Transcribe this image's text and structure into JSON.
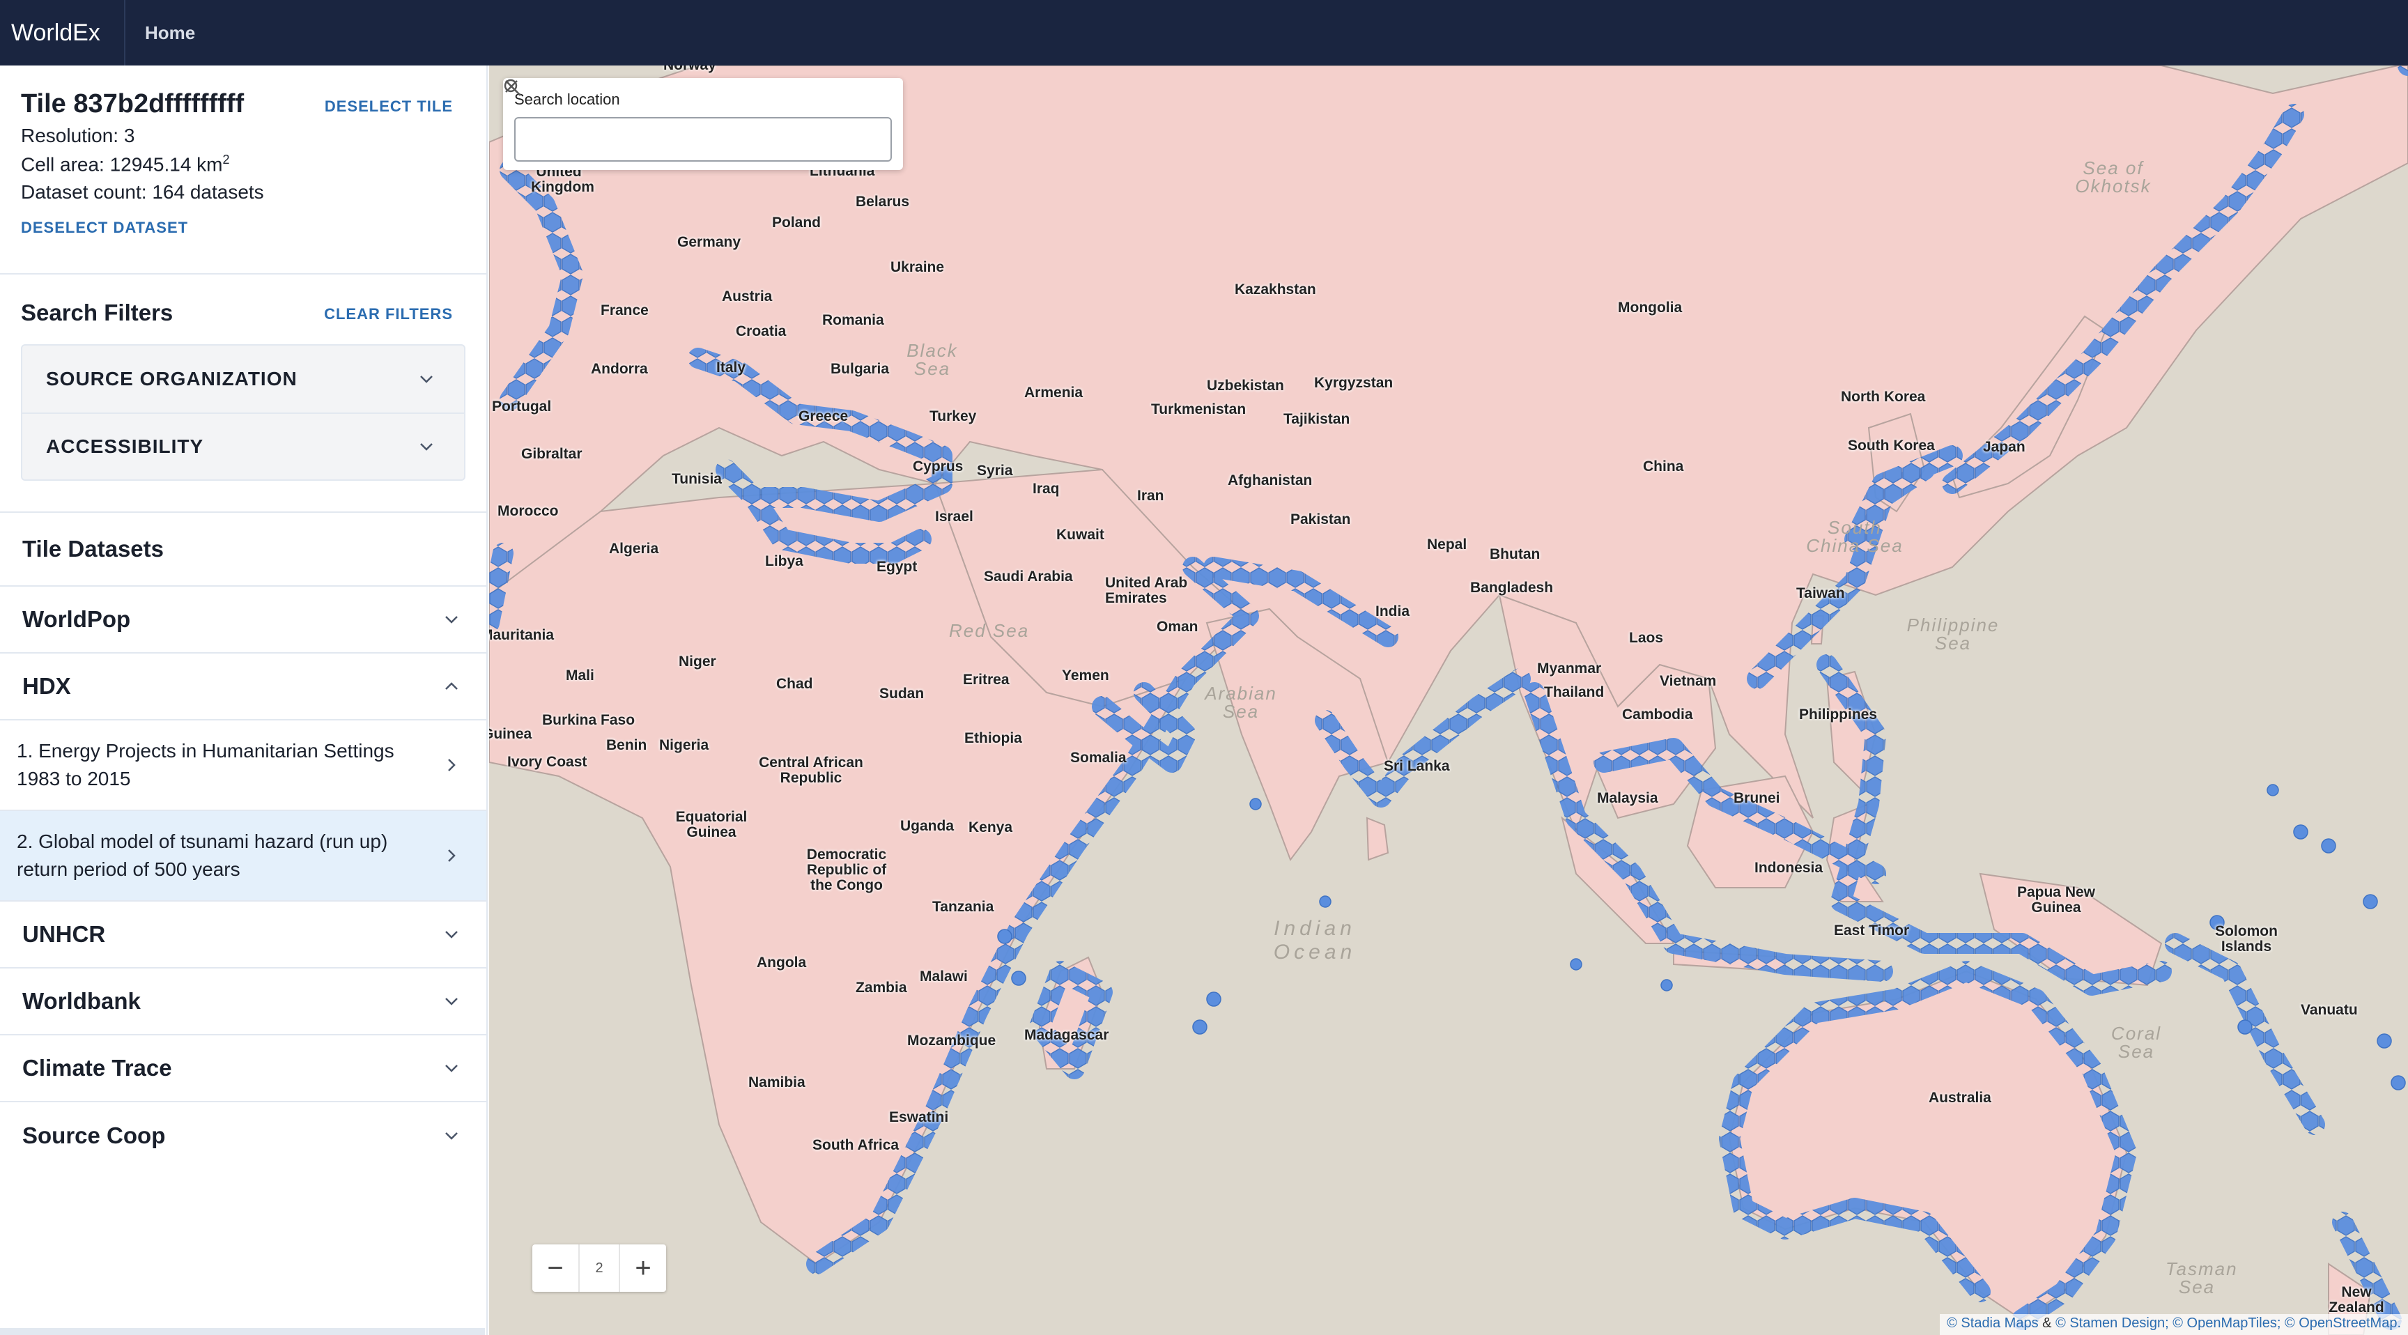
{
  "app": {
    "brand": "WorldEx",
    "nav_home": "Home"
  },
  "tile": {
    "title": "Tile 837b2dfffffffff",
    "deselect_tile": "DESELECT TILE",
    "resolution": "Resolution: 3",
    "cell_area_prefix": "Cell area: 12945.14 km",
    "cell_area_sup": "2",
    "dataset_count": "Dataset count: 164 datasets",
    "deselect_dataset": "DESELECT DATASET"
  },
  "filters": {
    "title": "Search Filters",
    "clear": "CLEAR FILTERS",
    "items": [
      {
        "label": "SOURCE ORGANIZATION"
      },
      {
        "label": "ACCESSIBILITY"
      }
    ]
  },
  "datasets": {
    "title": "Tile Datasets",
    "groups": [
      {
        "label": "WorldPop",
        "expanded": false
      },
      {
        "label": "HDX",
        "expanded": true
      },
      {
        "label": "UNHCR",
        "expanded": false
      },
      {
        "label": "Worldbank",
        "expanded": false
      },
      {
        "label": "Climate Trace",
        "expanded": false
      },
      {
        "label": "Source Coop",
        "expanded": false
      }
    ],
    "hdx_items": [
      {
        "label": "1. Energy Projects in Humanitarian Settings 1983 to 2015",
        "selected": false
      },
      {
        "label": "2. Global model of tsunami hazard (run up) return period of 500 years",
        "selected": true
      }
    ]
  },
  "map": {
    "search_label": "Search location",
    "search_value": "",
    "search_placeholder": "",
    "zoom_level": "2",
    "zoom_out": "−",
    "zoom_in": "+",
    "attribution": {
      "stadia": "© Stadia Maps",
      "amp": "&",
      "stamen": "© Stamen Design;",
      "omt": "© OpenMapTiles;",
      "osm": "© OpenStreetMap."
    },
    "colors": {
      "hazard_hex": "#5b8ede",
      "land": "#f4d0cc",
      "water": "#ddd8cd"
    },
    "labels": [
      "Norway",
      "United Kingdom",
      "Lithuania",
      "Belarus",
      "Poland",
      "Germany",
      "Ukraine",
      "France",
      "Austria",
      "Romania",
      "Croatia",
      "Italy",
      "Bulgaria",
      "Andorra",
      "Portugal",
      "Gibraltar",
      "Greece",
      "Turkey",
      "Cyprus",
      "Syria",
      "Tunisia",
      "Morocco",
      "Algeria",
      "Libya",
      "Egypt",
      "Israel",
      "Iraq",
      "Kuwait",
      "Iran",
      "Saudi Arabia",
      "United Arab Emirates",
      "Oman",
      "Yemen",
      "Eritrea",
      "Sudan",
      "Chad",
      "Niger",
      "Mali",
      "Mauritania",
      "Burkina Faso",
      "Benin",
      "Nigeria",
      "Ivory Coast",
      "Guinea",
      "Central African Republic",
      "Ethiopia",
      "Somalia",
      "Equatorial Guinea",
      "Democratic Republic of the Congo",
      "Uganda",
      "Kenya",
      "Tanzania",
      "Angola",
      "Zambia",
      "Malawi",
      "Mozambique",
      "Madagascar",
      "Namibia",
      "Eswatini",
      "South Africa",
      "Kazakhstan",
      "Uzbekistan",
      "Kyrgyzstan",
      "Turkmenistan",
      "Tajikistan",
      "Armenia",
      "Afghanistan",
      "Pakistan",
      "Nepal",
      "Bhutan",
      "India",
      "Bangladesh",
      "Sri Lanka",
      "Myanmar",
      "Thailand",
      "Laos",
      "Vietnam",
      "Cambodia",
      "Malaysia",
      "Brunei",
      "Indonesia",
      "Philippines",
      "Taiwan",
      "China",
      "Mongolia",
      "North Korea",
      "South Korea",
      "Japan",
      "Papua New Guinea",
      "East Timor",
      "Solomon Islands",
      "Vanuatu",
      "Australia",
      "New Zealand"
    ],
    "seas": [
      "Sea of Okhotsk",
      "Black Sea",
      "Red Sea",
      "Arabian Sea",
      "Indian Ocean",
      "South China Sea",
      "Philippine Sea",
      "Coral Sea",
      "Tasman Sea"
    ]
  }
}
